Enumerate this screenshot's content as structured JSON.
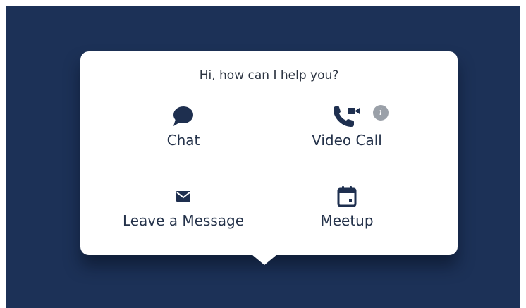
{
  "popup": {
    "greeting": "Hi, how can I help you?",
    "options": [
      {
        "label": "Chat",
        "icon": "chat-bubble-icon"
      },
      {
        "label": "Video Call",
        "icon": "video-call-icon"
      },
      {
        "label": "Leave a Message",
        "icon": "envelope-icon"
      },
      {
        "label": "Meetup",
        "icon": "calendar-icon"
      }
    ],
    "info_glyph": "i"
  },
  "colors": {
    "background": "#1c3157",
    "popup": "#ffffff",
    "icon": "#1e2f4f",
    "info_badge": "#9aa0a8"
  }
}
